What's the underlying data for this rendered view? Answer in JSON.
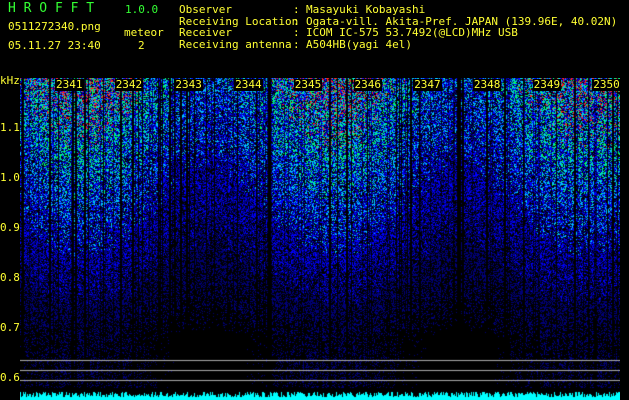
{
  "header": {
    "app_name": "H R O F F T",
    "version": "1.0.0",
    "filename": "0511272340.png",
    "datetime": "05.11.27 23:40",
    "meteor_label": "meteor",
    "meteor_count": "2",
    "fields": [
      {
        "label": "Observer",
        "value": "Masayuki Kobayashi"
      },
      {
        "label": "Receiving Location",
        "value": "Ogata-vill. Akita-Pref. JAPAN (139.96E, 40.02N)"
      },
      {
        "label": "Receiver",
        "value": "ICOM IC-575 53.7492(@LCD)MHz USB"
      },
      {
        "label": "Receiving antenna",
        "value": "A504HB(yagi 4el)"
      }
    ]
  },
  "colors": {
    "text": "#ffff33",
    "title": "#33ff33",
    "histogram": "#00ffff",
    "reference_lines": "#aaaaaa"
  },
  "chart_data": {
    "type": "heatmap",
    "ylabel": "kHz",
    "yticks": [
      "1.1",
      "1.0",
      "0.9",
      "0.8",
      "0.7",
      "0.6"
    ],
    "ytick_values": [
      1.1,
      1.0,
      0.9,
      0.8,
      0.7,
      0.6
    ],
    "ylim": [
      0.58,
      1.2
    ],
    "xticks": [
      "2341",
      "2342",
      "2343",
      "2344",
      "2345",
      "2346",
      "2347",
      "2348",
      "2349",
      "2350"
    ],
    "colormap": [
      "#000000",
      "#0000ff",
      "#00ffff",
      "#00ff00",
      "#ff0000"
    ],
    "reference_lines_khz": [
      0.62,
      0.6,
      0.58
    ]
  }
}
